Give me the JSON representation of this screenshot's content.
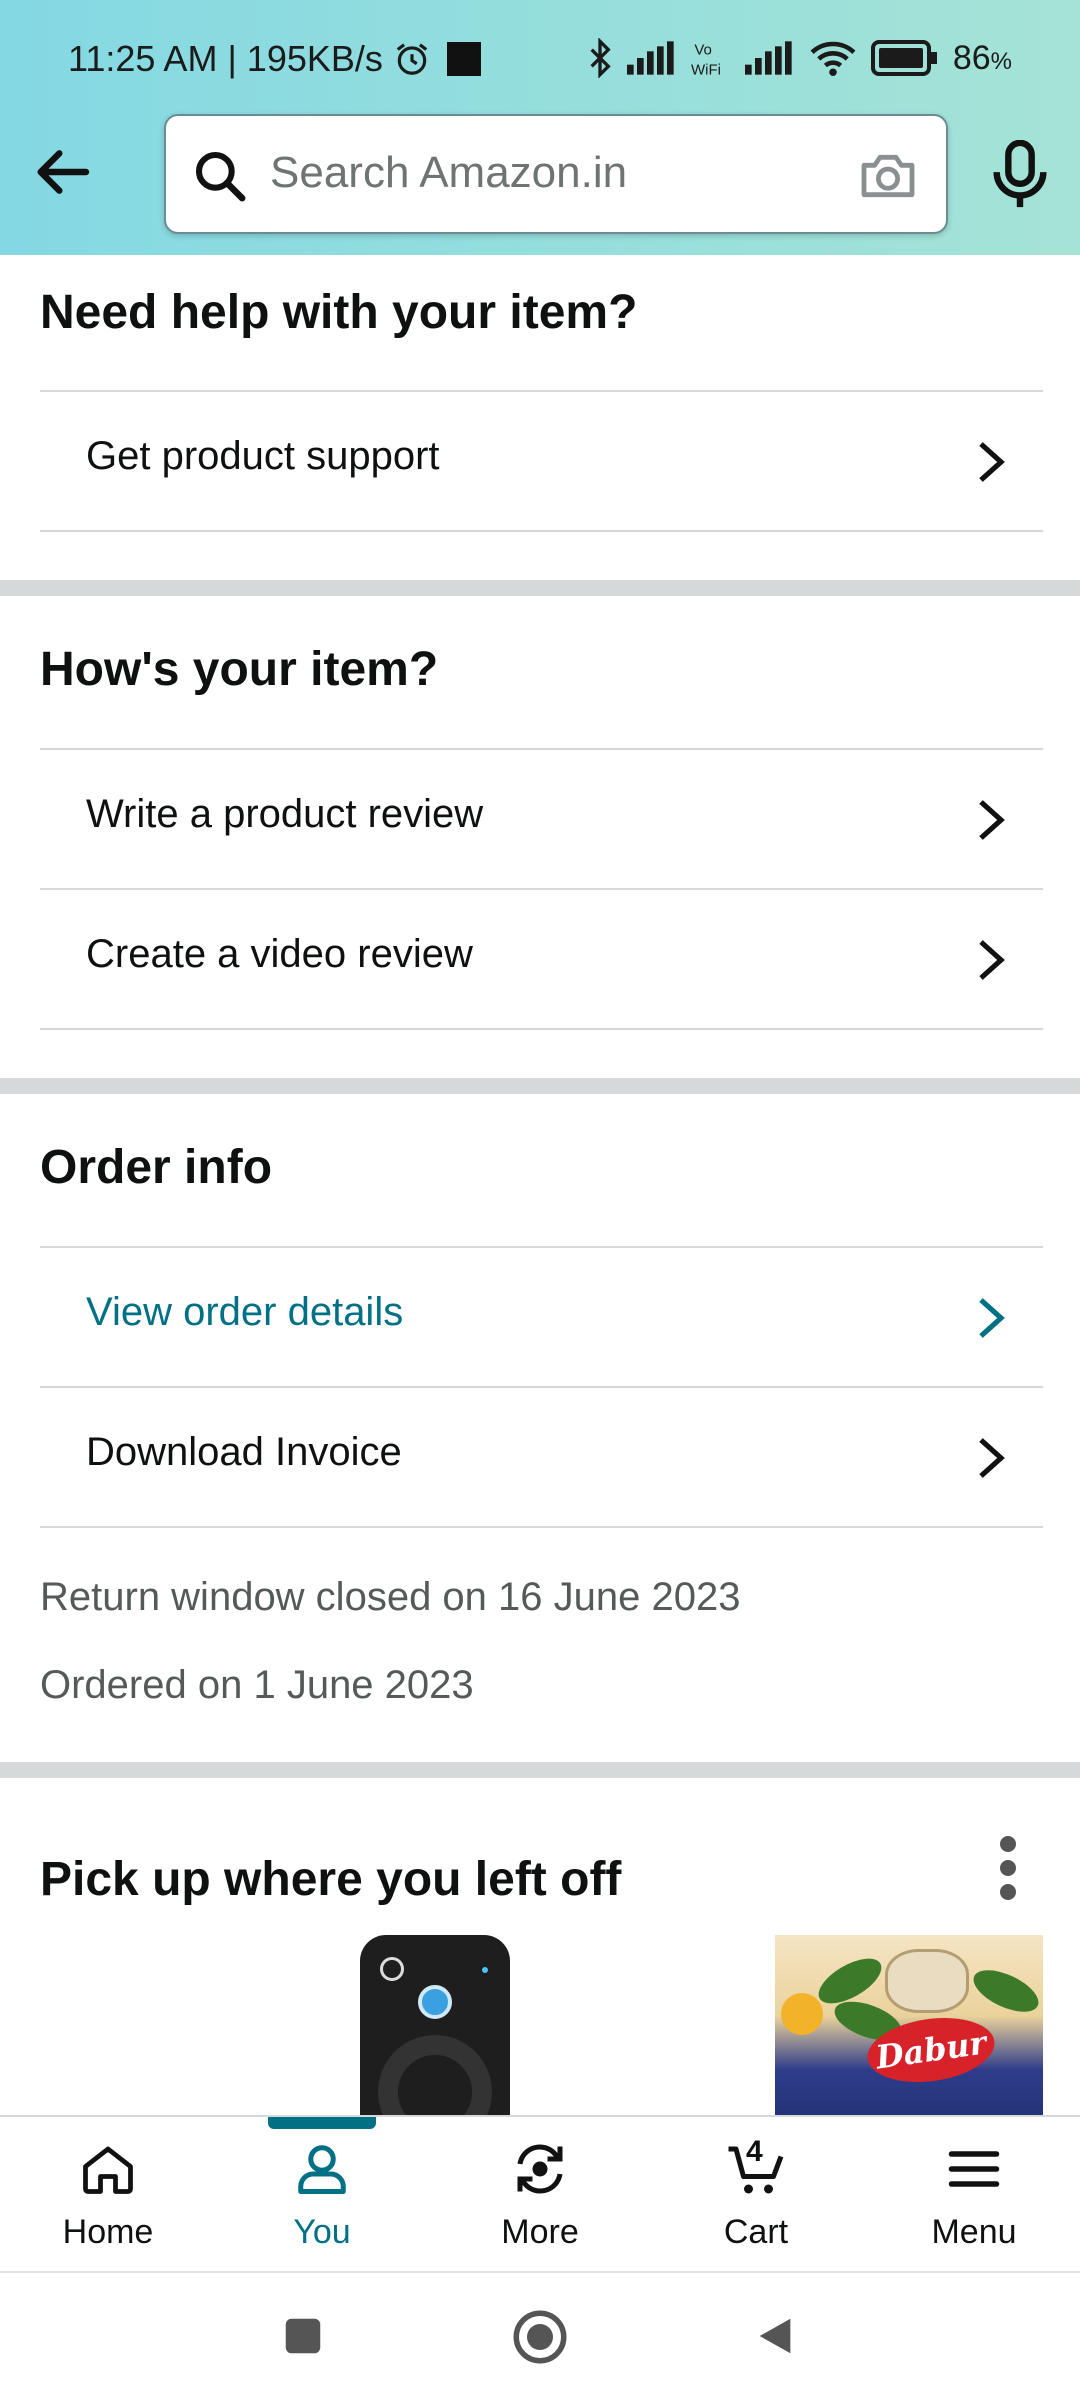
{
  "status_bar": {
    "time": "11:25 AM",
    "speed": "195KB/s",
    "battery": "86",
    "battery_unit": "%"
  },
  "search": {
    "placeholder": "Search Amazon.in"
  },
  "sections": {
    "help": {
      "title": "Need help with your item?",
      "items": [
        "Get product support"
      ]
    },
    "item": {
      "title": "How's your item?",
      "items": [
        "Write a product review",
        "Create a video review"
      ]
    },
    "order": {
      "title": "Order info",
      "items": [
        "View order details",
        "Download Invoice"
      ],
      "return_text": "Return window closed on 16 June 2023",
      "ordered_text": "Ordered on 1 June 2023"
    },
    "recent": {
      "title": "Pick up where you left off",
      "brand_text": "Dabur"
    }
  },
  "bottom_nav": {
    "items": [
      "Home",
      "You",
      "More",
      "Cart",
      "Menu"
    ],
    "active": "You",
    "cart_count": "4"
  },
  "colors": {
    "link": "#007185",
    "header_start": "#84d8e3",
    "header_end": "#a5e3d6",
    "divider": "#d5d9d9"
  }
}
